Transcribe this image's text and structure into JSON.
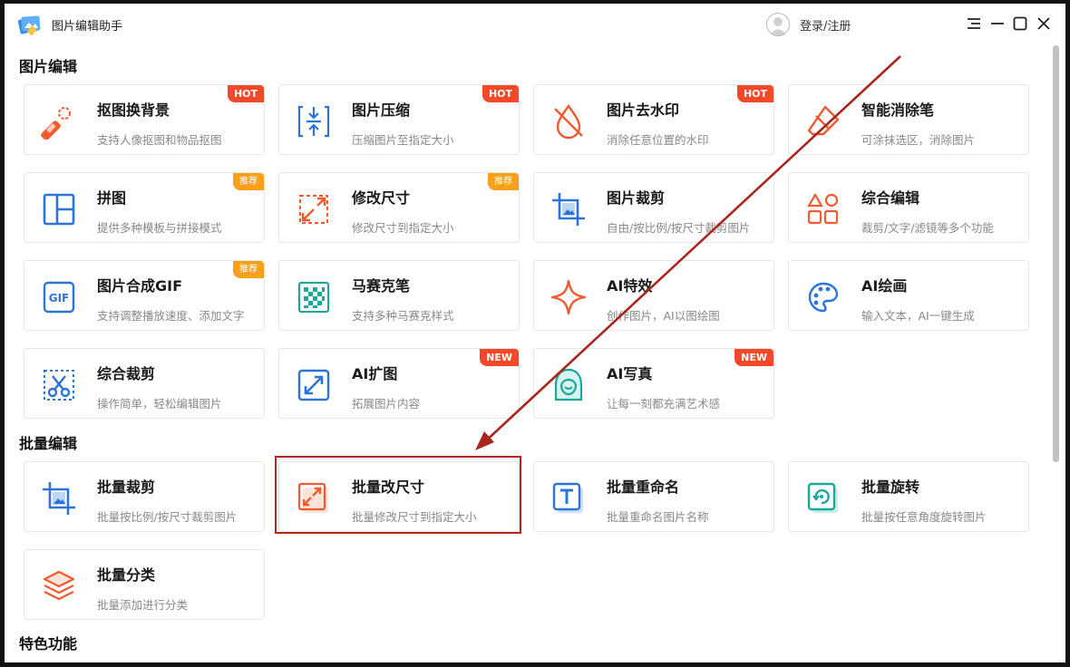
{
  "app": {
    "title": "图片编辑助手",
    "login_label": "登录/注册"
  },
  "window_controls": [
    "menu-icon",
    "minimize-icon",
    "maximize-icon",
    "close-icon"
  ],
  "colors": {
    "accent_blue": "#2c74d8",
    "accent_orange": "#ef5b2f",
    "hot_badge": "#f2492b",
    "recommend_badge": "#f9a01b",
    "highlight_box": "#b3261e"
  },
  "sections": {
    "edit": {
      "title": "图片编辑"
    },
    "batch": {
      "title": "批量编辑"
    },
    "featured": {
      "title": "特色功能"
    }
  },
  "edit_tools": [
    {
      "name": "抠图换背景",
      "desc": "支持人像抠图和物品抠图",
      "badge": "HOT",
      "icon": "eraser-pen-icon"
    },
    {
      "name": "图片压缩",
      "desc": "压缩图片至指定大小",
      "badge": "HOT",
      "icon": "compress-icon"
    },
    {
      "name": "图片去水印",
      "desc": "消除任意位置的水印",
      "badge": "HOT",
      "icon": "water-drop-icon"
    },
    {
      "name": "智能消除笔",
      "desc": "可涂抹选区，消除图片",
      "badge": "",
      "icon": "eraser-icon"
    },
    {
      "name": "拼图",
      "desc": "提供多种模板与拼接模式",
      "badge": "推荐",
      "icon": "collage-icon"
    },
    {
      "name": "修改尺寸",
      "desc": "修改尺寸到指定大小",
      "badge": "推荐",
      "icon": "resize-icon"
    },
    {
      "name": "图片裁剪",
      "desc": "自由/按比例/按尺寸裁剪图片",
      "badge": "",
      "icon": "crop-icon"
    },
    {
      "name": "综合编辑",
      "desc": "裁剪/文字/滤镜等多个功能",
      "badge": "",
      "icon": "shapes-icon"
    },
    {
      "name": "图片合成GIF",
      "desc": "支持调整播放速度、添加文字",
      "badge": "推荐",
      "icon": "gif-icon"
    },
    {
      "name": "马赛克笔",
      "desc": "支持多种马赛克样式",
      "badge": "",
      "icon": "mosaic-icon"
    },
    {
      "name": "AI特效",
      "desc": "创作图片，AI以图绘图",
      "badge": "",
      "icon": "sparkle-icon"
    },
    {
      "name": "AI绘画",
      "desc": "输入文本，AI一键生成",
      "badge": "",
      "icon": "palette-icon"
    },
    {
      "name": "综合裁剪",
      "desc": "操作简单，轻松编辑图片",
      "badge": "",
      "icon": "scissors-icon"
    },
    {
      "name": "AI扩图",
      "desc": "拓展图片内容",
      "badge": "NEW",
      "icon": "expand-icon"
    },
    {
      "name": "AI写真",
      "desc": "让每一刻都充满艺术感",
      "badge": "NEW",
      "icon": "portrait-icon"
    }
  ],
  "batch_tools": [
    {
      "name": "批量裁剪",
      "desc": "批量按比例/按尺寸裁剪图片",
      "badge": "",
      "icon": "batch-crop-icon"
    },
    {
      "name": "批量改尺寸",
      "desc": "批量修改尺寸到指定大小",
      "badge": "",
      "icon": "batch-resize-icon"
    },
    {
      "name": "批量重命名",
      "desc": "批量重命名图片名称",
      "badge": "",
      "icon": "rename-icon"
    },
    {
      "name": "批量旋转",
      "desc": "批量按任意角度旋转图片",
      "badge": "",
      "icon": "rotate-icon"
    },
    {
      "name": "批量分类",
      "desc": "批量添加进行分类",
      "badge": "",
      "icon": "layers-icon"
    }
  ]
}
